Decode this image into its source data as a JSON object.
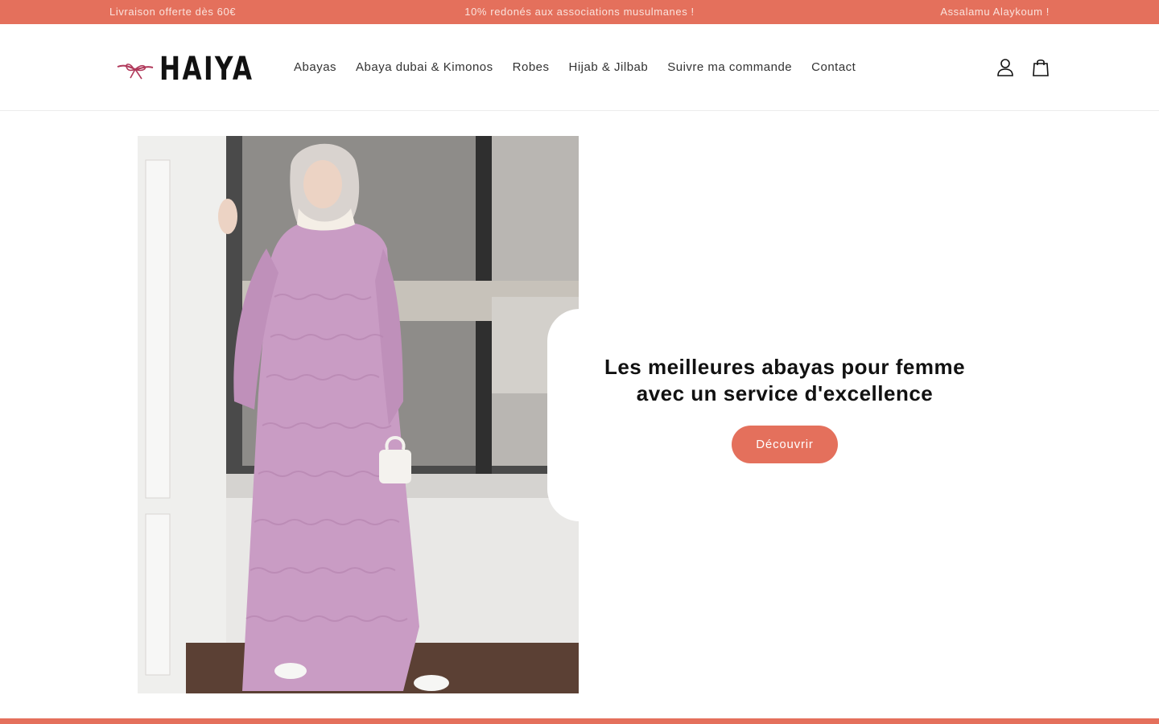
{
  "announcement": {
    "left": "Livraison offerte dès 60€",
    "center": "10% redonés aux associations musulmanes !",
    "right": "Assalamu Alaykoum !"
  },
  "brand": {
    "name": "HAIYA"
  },
  "nav": [
    {
      "label": "Abayas"
    },
    {
      "label": "Abaya dubai & Kimonos"
    },
    {
      "label": "Robes"
    },
    {
      "label": "Hijab & Jilbab"
    },
    {
      "label": "Suivre ma commande"
    },
    {
      "label": "Contact"
    }
  ],
  "icons": {
    "account": "user-icon",
    "cart": "shopping-bag-icon"
  },
  "hero": {
    "heading_line1": "Les meilleures abayas pour femme",
    "heading_line2": "avec un service d'excellence",
    "cta_label": "Découvrir"
  },
  "colors": {
    "accent": "#e4705c",
    "dress": "#c99cc4"
  }
}
